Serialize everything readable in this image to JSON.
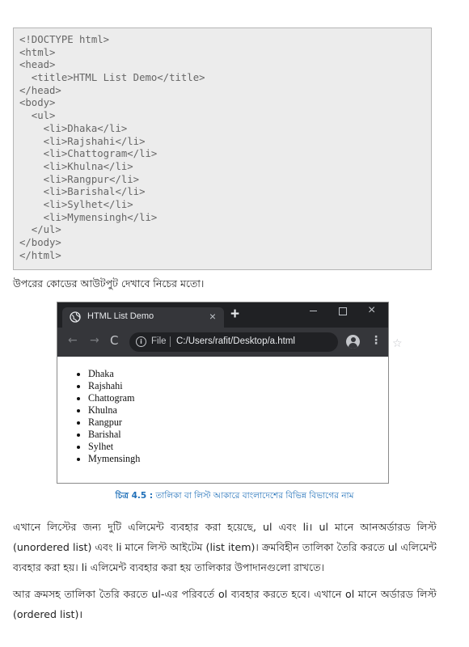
{
  "code_listing": {
    "lines": [
      "<!DOCTYPE html>",
      "<html>",
      "<head>",
      "  <title>HTML List Demo</title>",
      "</head>",
      "<body>",
      "  <ul>",
      "    <li>Dhaka</li>",
      "    <li>Rajshahi</li>",
      "    <li>Chattogram</li>",
      "    <li>Khulna</li>",
      "    <li>Rangpur</li>",
      "    <li>Barishal</li>",
      "    <li>Sylhet</li>",
      "    <li>Mymensingh</li>",
      "  </ul>",
      "</body>",
      "</html>"
    ]
  },
  "output_intro": "উপরের কোডের আউটপুট দেখাবে নিচের মতো।",
  "browser": {
    "tab_title": "HTML List Demo",
    "tab_close": "×",
    "new_tab": "+",
    "window_close": "×",
    "address_prefix": "File",
    "address_url": "C:/Users/rafit/Desktop/a.html",
    "info_glyph": "i",
    "back_glyph": "←",
    "forward_glyph": "→",
    "reload_glyph": "C",
    "star_glyph": "☆",
    "menu_glyph": "⋮",
    "list_items": [
      "Dhaka",
      "Rajshahi",
      "Chattogram",
      "Khulna",
      "Rangpur",
      "Barishal",
      "Sylhet",
      "Mymensingh"
    ]
  },
  "figure_caption": {
    "number": "চিত্র 4.5 :",
    "text": "তালিকা বা লিস্ট আকারে বাংলাদেশের বিভিন্ন বিভাগের নাম"
  },
  "paragraphs": [
    "এখানে লিস্টের জন্য দুটি এলিমেন্ট ব্যবহার করা হয়েছে, ul এবং li। ul মানে আনঅর্ডারড লিস্ট (unordered list) এবং li মানে লিস্ট আইটেম (list item)। ক্রমবিহীন তালিকা তৈরি করতে ul এলিমেন্ট ব্যবহার করা হয়। li এলিমেন্ট ব্যবহার করা হয় তালিকার উপাদানগুলো রাখতে।",
    "আর ক্রমসহ তালিকা তৈরি করতে ul-এর পরিবর্তে ol ব্যবহার করতে হবে। এখানে ol মানে অর্ডারড লিস্ট (ordered list)।"
  ],
  "colors": {
    "caption_blue": "#1f6fb8",
    "code_background": "#ececec",
    "browser_titlebar": "#202124",
    "browser_toolbar": "#35363a"
  }
}
